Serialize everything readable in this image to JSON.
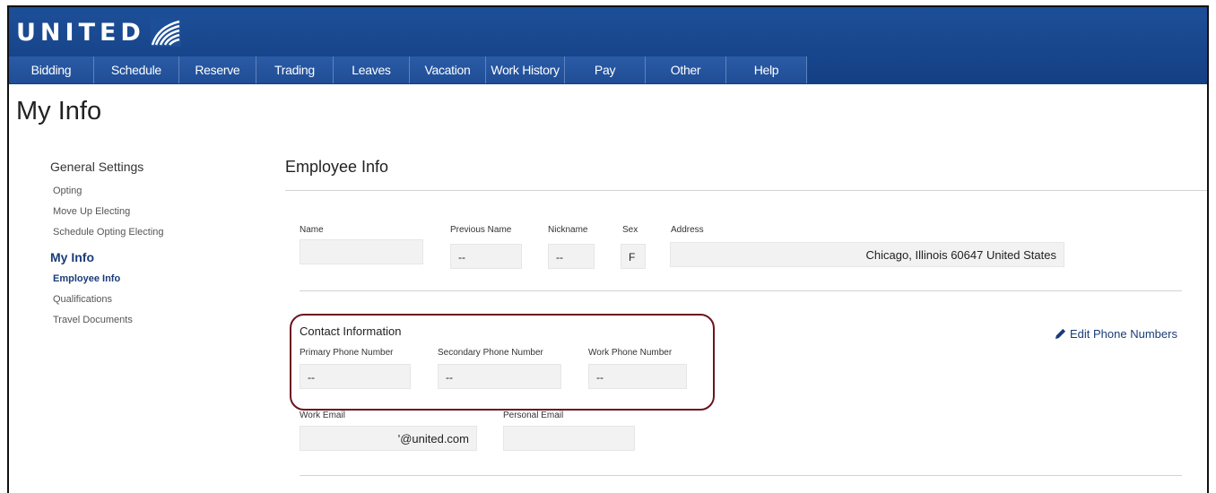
{
  "header": {
    "logo_text": "UNITED",
    "nav": [
      {
        "label": "Bidding"
      },
      {
        "label": "Schedule"
      },
      {
        "label": "Reserve"
      },
      {
        "label": "Trading"
      },
      {
        "label": "Leaves"
      },
      {
        "label": "Vacation"
      },
      {
        "label": "Work History"
      },
      {
        "label": "Pay"
      },
      {
        "label": "Other"
      },
      {
        "label": "Help"
      }
    ]
  },
  "page_title": "My Info",
  "sidebar": {
    "heading": "General Settings",
    "general_items": [
      "Opting",
      "Move Up Electing",
      "Schedule Opting Electing"
    ],
    "my_info_heading": "My Info",
    "my_info_items": [
      "Employee Info",
      "Qualifications",
      "Travel Documents"
    ]
  },
  "main": {
    "section_title": "Employee Info",
    "fields": {
      "name": {
        "label": "Name",
        "value": ""
      },
      "previous_name": {
        "label": "Previous Name",
        "value": "--"
      },
      "nickname": {
        "label": "Nickname",
        "value": "--"
      },
      "sex": {
        "label": "Sex",
        "value": "F"
      },
      "address": {
        "label": "Address",
        "value": "Chicago, Illinois 60647   United States"
      }
    },
    "contact": {
      "title": "Contact Information",
      "primary": {
        "label": "Primary Phone Number",
        "value": "--"
      },
      "secondary": {
        "label": "Secondary Phone Number",
        "value": "--"
      },
      "work": {
        "label": "Work Phone Number",
        "value": "--"
      },
      "edit_label": "Edit Phone Numbers"
    },
    "email": {
      "work": {
        "label": "Work Email",
        "value": "'@united.com"
      },
      "personal": {
        "label": "Personal Email",
        "value": ""
      }
    }
  },
  "colors": {
    "header_blue": "#1d4f98",
    "link_blue": "#1a3c78",
    "highlight_border": "#6b1420"
  }
}
